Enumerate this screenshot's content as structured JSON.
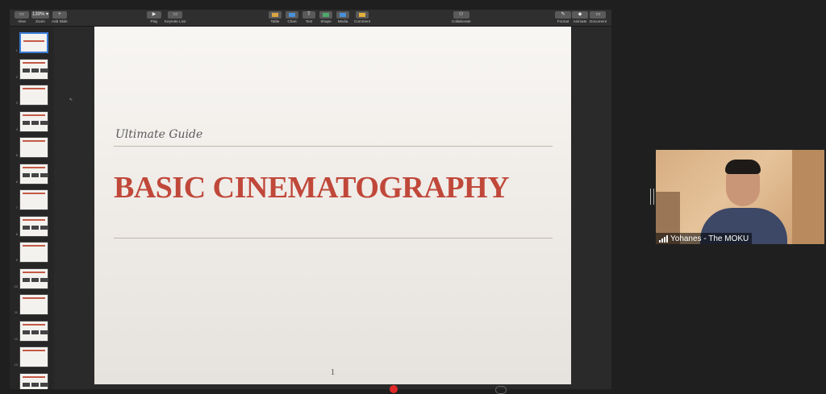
{
  "toolbar": {
    "left": [
      {
        "label": "View",
        "button": "▭"
      },
      {
        "label": "Zoom",
        "button": "139% ▾"
      },
      {
        "label": "Add Slide",
        "button": "+"
      }
    ],
    "center_left": [
      {
        "label": "Play",
        "button": "▶"
      },
      {
        "label": "Keynote Live",
        "button": "▭"
      }
    ],
    "center": [
      {
        "label": "Table",
        "color": "#d9a441"
      },
      {
        "label": "Chart",
        "color": "#4a8fd8"
      },
      {
        "label": "Text",
        "glyph": "T"
      },
      {
        "label": "Shape",
        "color": "#4ea86b"
      },
      {
        "label": "Media",
        "color": "#4a8fd8"
      },
      {
        "label": "Comment",
        "color": "#e0b23a"
      }
    ],
    "collaborate": {
      "label": "Collaborate",
      "button": "⚇"
    },
    "right": [
      {
        "label": "Format",
        "button": "✎"
      },
      {
        "label": "Animate",
        "button": "◆"
      },
      {
        "label": "Document",
        "button": "▭"
      }
    ]
  },
  "thumbnails": [
    "1",
    "2",
    "3",
    "4",
    "5",
    "6",
    "7",
    "8",
    "9",
    "10",
    "11",
    "12",
    "13",
    "14"
  ],
  "slide": {
    "subtitle": "Ultimate Guide",
    "title": "BASIC CINEMATOGRAPHY",
    "page_number": "1"
  },
  "video": {
    "participant_name": "Yohanes - The MOKU"
  },
  "colors": {
    "accent_title": "#c0483a",
    "selection": "#3a7bd5",
    "recording": "#e02a2a"
  }
}
